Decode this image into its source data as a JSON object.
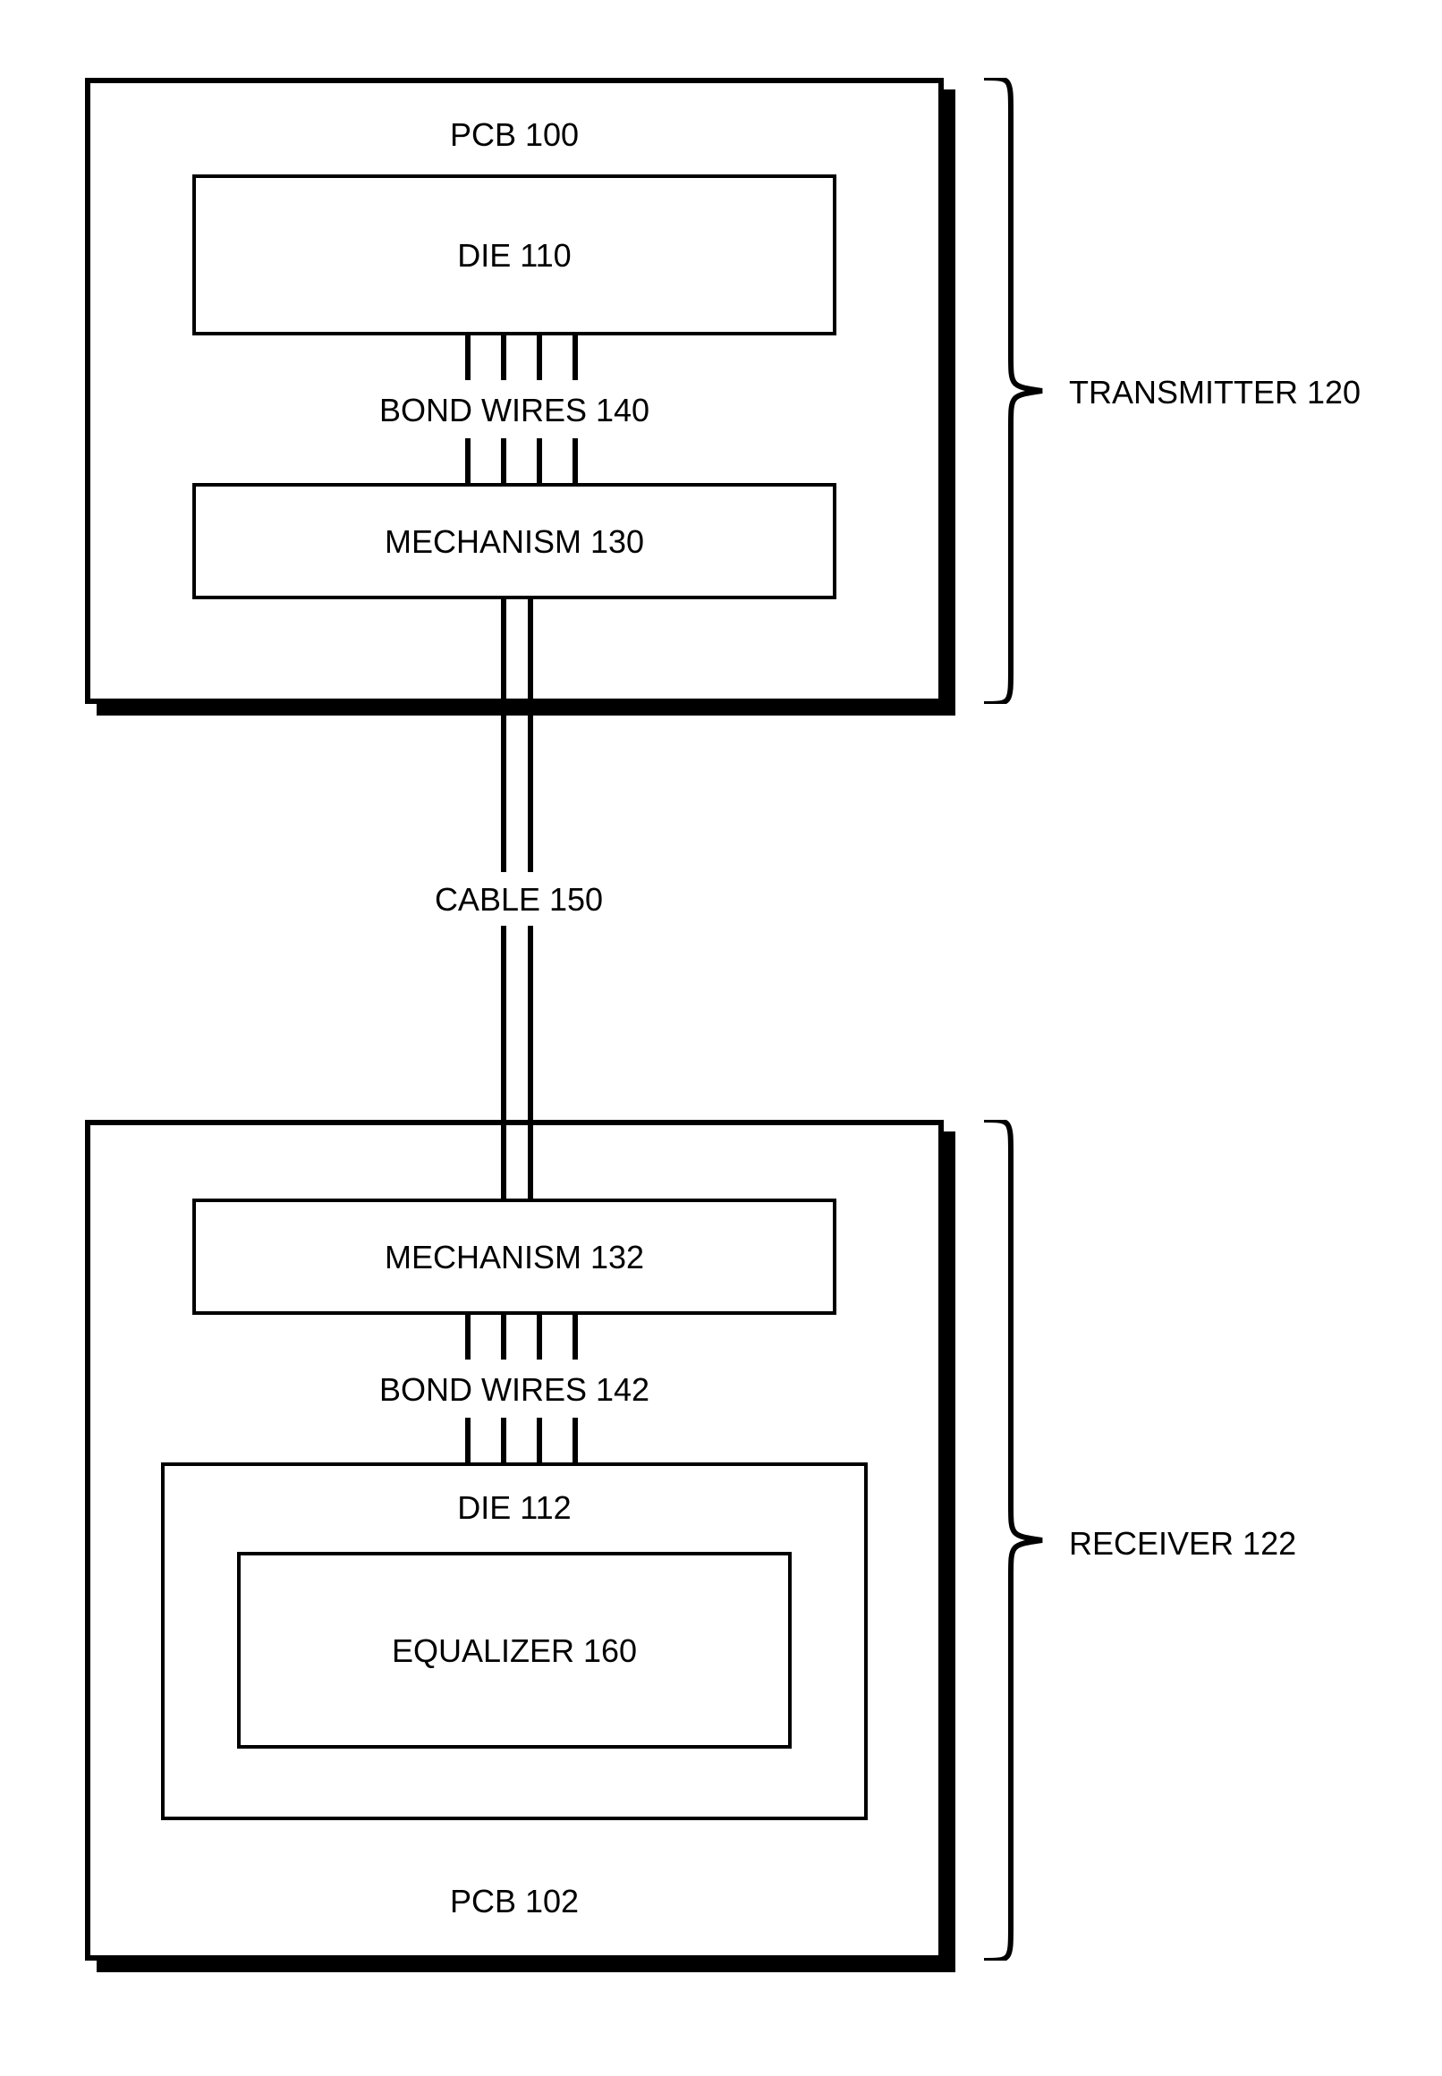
{
  "transmitter": {
    "pcb_label": "PCB 100",
    "die_label": "DIE 110",
    "bondwires_label": "BOND WIRES 140",
    "mechanism_label": "MECHANISM 130",
    "side_label": "TRANSMITTER 120"
  },
  "cable_label": "CABLE 150",
  "receiver": {
    "pcb_label": "PCB 102",
    "mechanism_label": "MECHANISM 132",
    "bondwires_label": "BOND WIRES 142",
    "die_label": "DIE 112",
    "equalizer_label": "EQUALIZER 160",
    "side_label": "RECEIVER 122"
  }
}
